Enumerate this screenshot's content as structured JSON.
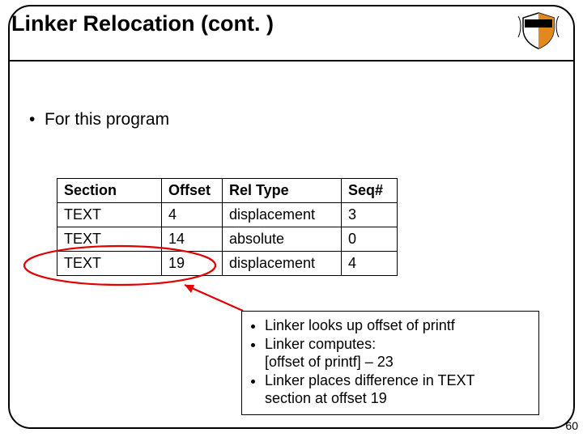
{
  "title": "Linker Relocation (cont. )",
  "bullet_intro": "For this program",
  "table": {
    "headers": {
      "section": "Section",
      "offset": "Offset",
      "rel": "Rel Type",
      "seq": "Seq#"
    },
    "rows": [
      {
        "section": "TEXT",
        "offset": "4",
        "rel": "displacement",
        "seq": "3"
      },
      {
        "section": "TEXT",
        "offset": "14",
        "rel": "absolute",
        "seq": "0"
      },
      {
        "section": "TEXT",
        "offset": "19",
        "rel": "displacement",
        "seq": "4"
      }
    ]
  },
  "annotation": {
    "l1": "Linker looks up offset of printf",
    "l2": "Linker computes:",
    "l2b": "[offset of printf] – 23",
    "l3": "Linker places difference in TEXT",
    "l3b": "section at offset 19"
  },
  "page_number": "60"
}
